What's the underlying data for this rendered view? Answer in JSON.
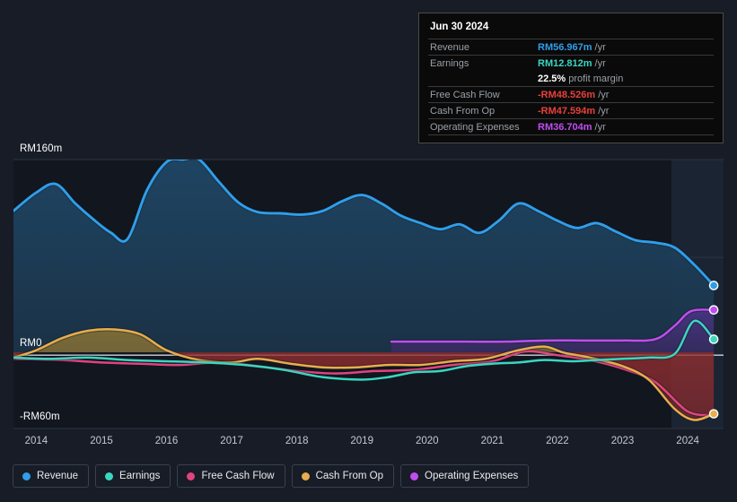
{
  "axes": {
    "y_top_label": "RM160m",
    "y_zero_label": "RM0",
    "y_bottom_label": "-RM60m",
    "x_labels": [
      "2014",
      "2015",
      "2016",
      "2017",
      "2018",
      "2019",
      "2020",
      "2021",
      "2022",
      "2023",
      "2024"
    ]
  },
  "tooltip": {
    "date": "Jun 30 2024",
    "rows": [
      {
        "label": "Revenue",
        "value": "RM56.967m",
        "unit": "/yr",
        "color": "#2f9eea"
      },
      {
        "label": "Earnings",
        "value": "RM12.812m",
        "unit": "/yr",
        "color": "#3ad6c0"
      },
      {
        "label": "Free Cash Flow",
        "value": "-RM48.526m",
        "unit": "/yr",
        "color": "#e8403a"
      },
      {
        "label": "Cash From Op",
        "value": "-RM47.594m",
        "unit": "/yr",
        "color": "#e8403a"
      },
      {
        "label": "Operating Expenses",
        "value": "RM36.704m",
        "unit": "/yr",
        "color": "#c04df0"
      }
    ],
    "profit_margin_value": "22.5%",
    "profit_margin_label": "profit margin"
  },
  "legend": [
    {
      "label": "Revenue",
      "color": "#2f9eea"
    },
    {
      "label": "Earnings",
      "color": "#3ad6c0"
    },
    {
      "label": "Free Cash Flow",
      "color": "#e0447e"
    },
    {
      "label": "Cash From Op",
      "color": "#e8a council"
    },
    {
      "label": "Operating Expenses",
      "color": "#c04df0"
    }
  ],
  "chart_data": {
    "type": "area",
    "title": "",
    "xlabel": "",
    "ylabel": "RM",
    "ylim": [
      -60,
      160
    ],
    "xlim": [
      2013.65,
      2024.55
    ],
    "grid": true,
    "gridlines_y": [
      160,
      80,
      0,
      -60
    ],
    "legend_position": "bottom",
    "currency": "RM",
    "units": "millions",
    "forecast_region_start_x": 2023.75,
    "series": [
      {
        "name": "Revenue",
        "color": "#2f9eea",
        "fill": "#1d3c55",
        "x": [
          2013.65,
          2014.0,
          2014.3,
          2014.6,
          2014.9,
          2015.15,
          2015.4,
          2015.7,
          2016.0,
          2016.25,
          2016.5,
          2016.8,
          2017.1,
          2017.4,
          2017.75,
          2018.1,
          2018.4,
          2018.7,
          2019.0,
          2019.3,
          2019.6,
          2019.9,
          2020.2,
          2020.5,
          2020.8,
          2021.1,
          2021.4,
          2021.7,
          2022.0,
          2022.3,
          2022.6,
          2022.9,
          2023.2,
          2023.5,
          2023.8,
          2024.1,
          2024.4
        ],
        "y": [
          118,
          133,
          140,
          124,
          110,
          100,
          95,
          135,
          158,
          160,
          160,
          142,
          125,
          117,
          116,
          115,
          118,
          126,
          131,
          124,
          114,
          108,
          103,
          107,
          100,
          110,
          124,
          118,
          110,
          104,
          108,
          101,
          94,
          92,
          88,
          74,
          57
        ]
      },
      {
        "name": "Earnings",
        "color": "#3ad6c0",
        "x": [
          2013.65,
          2014.2,
          2014.8,
          2015.4,
          2016.0,
          2016.6,
          2017.2,
          2017.8,
          2018.4,
          2019.0,
          2019.4,
          2019.8,
          2020.2,
          2020.6,
          2021.0,
          2021.4,
          2021.8,
          2022.2,
          2022.6,
          2023.0,
          2023.4,
          2023.8,
          2024.1,
          2024.4
        ],
        "y": [
          -2,
          -3,
          -2,
          -4,
          -5,
          -6,
          -8,
          -12,
          -18,
          -20,
          -18,
          -14,
          -13,
          -9,
          -7,
          -6,
          -4,
          -5,
          -4,
          -3,
          -2,
          1,
          28,
          13
        ]
      },
      {
        "name": "Free Cash Flow",
        "color": "#e0447e",
        "x": [
          2013.65,
          2014.4,
          2015.0,
          2015.6,
          2016.2,
          2016.8,
          2017.4,
          2018.0,
          2018.6,
          2019.2,
          2019.8,
          2020.4,
          2021.0,
          2021.5,
          2022.0,
          2022.5,
          2023.0,
          2023.5,
          2024.0,
          2024.4
        ],
        "y": [
          -3,
          -4,
          -6,
          -7,
          -8,
          -6,
          -9,
          -13,
          -15,
          -13,
          -12,
          -8,
          -5,
          3,
          0,
          -4,
          -11,
          -22,
          -46,
          -49
        ]
      },
      {
        "name": "Cash From Op",
        "color": "#e8ad4d",
        "fill": "#6d5c34",
        "x": [
          2013.65,
          2014.0,
          2014.4,
          2014.8,
          2015.2,
          2015.6,
          2016.0,
          2016.5,
          2017.0,
          2017.4,
          2017.9,
          2018.4,
          2018.9,
          2019.4,
          2019.9,
          2020.4,
          2020.9,
          2021.4,
          2021.8,
          2022.1,
          2022.5,
          2023.0,
          2023.4,
          2023.8,
          2024.1,
          2024.4
        ],
        "y": [
          -2,
          4,
          14,
          20,
          21,
          17,
          4,
          -4,
          -6,
          -3,
          -7,
          -10,
          -10,
          -8,
          -8,
          -5,
          -3,
          4,
          7,
          2,
          -2,
          -9,
          -20,
          -44,
          -53,
          -48
        ]
      },
      {
        "name": "Operating Expenses",
        "color": "#c04df0",
        "fill": "#3b2b60",
        "x": [
          2019.45,
          2020.0,
          2020.6,
          2021.2,
          2021.8,
          2022.4,
          2023.0,
          2023.5,
          2023.8,
          2024.05,
          2024.4
        ],
        "y": [
          11,
          11,
          11,
          11,
          12,
          12,
          12,
          13,
          24,
          36,
          37
        ]
      }
    ],
    "endpoints": [
      {
        "name": "Revenue",
        "x": 2024.4,
        "y": 57,
        "color": "#2f9eea"
      },
      {
        "name": "Operating Expenses",
        "x": 2024.4,
        "y": 37,
        "color": "#c04df0"
      },
      {
        "name": "Earnings",
        "x": 2024.4,
        "y": 13,
        "color": "#3ad6c0"
      },
      {
        "name": "Cash From Op",
        "x": 2024.4,
        "y": -48,
        "color": "#e8ad4d"
      }
    ]
  }
}
